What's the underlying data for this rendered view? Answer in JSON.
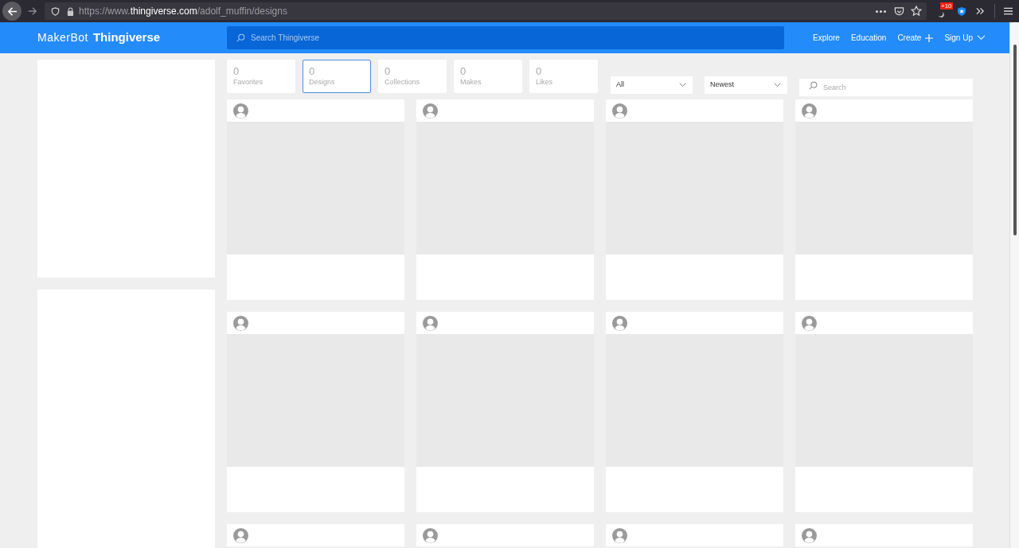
{
  "browser": {
    "url_prefix": "https://www.",
    "url_host": "thingiverse.com",
    "url_path": "/adolf_muffin/designs",
    "extension_badge": "+10"
  },
  "header": {
    "logo_first": "MakerBot",
    "logo_second": "Thingiverse",
    "search_placeholder": "Search Thingiverse",
    "nav": [
      {
        "label": "Explore",
        "kind": "link"
      },
      {
        "label": "Education",
        "kind": "link"
      },
      {
        "label": "Create",
        "kind": "plus"
      },
      {
        "label": "Sign Up",
        "kind": "dropdown"
      }
    ]
  },
  "stats": [
    {
      "count": "0",
      "label": "Favorites",
      "selected": false
    },
    {
      "count": "0",
      "label": "Designs",
      "selected": true
    },
    {
      "count": "0",
      "label": "Collections",
      "selected": false
    },
    {
      "count": "0",
      "label": "Makes",
      "selected": false
    },
    {
      "count": "0",
      "label": "Likes",
      "selected": false
    }
  ],
  "filters": {
    "type": "All",
    "sort": "Newest",
    "search_placeholder": "Search"
  },
  "cards": [
    {
      "kind": "placeholder"
    },
    {
      "kind": "placeholder"
    },
    {
      "kind": "placeholder"
    },
    {
      "kind": "placeholder"
    },
    {
      "kind": "placeholder"
    },
    {
      "kind": "placeholder"
    },
    {
      "kind": "placeholder"
    },
    {
      "kind": "placeholder"
    },
    {
      "kind": "cut_off"
    },
    {
      "kind": "cut_off"
    },
    {
      "kind": "cut_off"
    },
    {
      "kind": "cut_off"
    }
  ]
}
